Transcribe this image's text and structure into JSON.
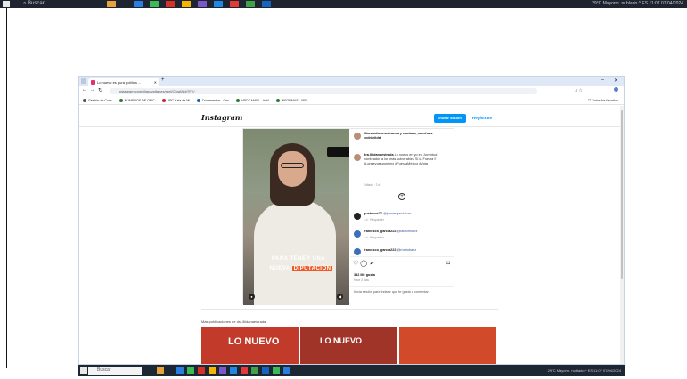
{
  "outer_taskbar": {
    "search_label": "Buscar",
    "tray_text": "29°C  Mayorm. nublado  ^  ES  11:07  07/04/2024"
  },
  "browser": {
    "tab_title": "Lo nuevo es pura política ...",
    "new_tab_label": "+",
    "url": "instagram.com/lilianamitanes/reel/C5qANdrTFY/",
    "bookmarks": [
      "Gestión de Cons...",
      "NÚMEROS DE OFIC...",
      "VPC Kala de Mi...",
      "Documentos - Ons...",
      "VPCC MAPL - Antil...",
      "INFORMAS - VPC..."
    ],
    "all_bookmarks_label": "Todos los favoritos"
  },
  "instagram": {
    "logo": "Instagram",
    "login_label": "Iniciar sesión",
    "register_label": "Regístrate",
    "post": {
      "video_caption_line1": "PARA TENER UNA",
      "video_caption_line2a": "NUEVA",
      "video_caption_line2b": "DIPUTACIÓN",
      "header_users": "lilianamitanesmiranda y mariana_sanchezz cedri.elidet",
      "header_more": "···",
      "caption_user": "dra.lilidanaestrada",
      "caption_text": "Lo nuevo en yo en Juventud nombrados a los más vulnerables Sí la Fuerza !! #Lonuevoesporelmx #FuerzaMéxico #Vota",
      "caption_meta": "Editado · 2 d",
      "comments": [
        {
          "user": "gustavoe77",
          "text": "@juanesgarcialum",
          "meta": "1 d  ·  Responder"
        },
        {
          "user": "francisco_garcia222",
          "text": "@lalincebaez",
          "meta": "1 d  ·  Responder"
        },
        {
          "user": "francisco_garcia222",
          "text": "@mariobaez",
          "meta": ""
        }
      ],
      "likes": "342 Me gusta",
      "time_ago": "Hace 2 días",
      "login_prompt": "Inicia sesión para indicar que te gusta o comentar."
    },
    "more_posts_title": "Más publicaciones de dra.lilidanaestrada",
    "thumb_texts": [
      "LO NUEVO",
      "LO NUEVO",
      ""
    ]
  },
  "inner_taskbar": {
    "search_label": "Buscar",
    "tray_text": "29°C  Mayorm. nublado  ^  ES  11:07  07/04/2024"
  }
}
